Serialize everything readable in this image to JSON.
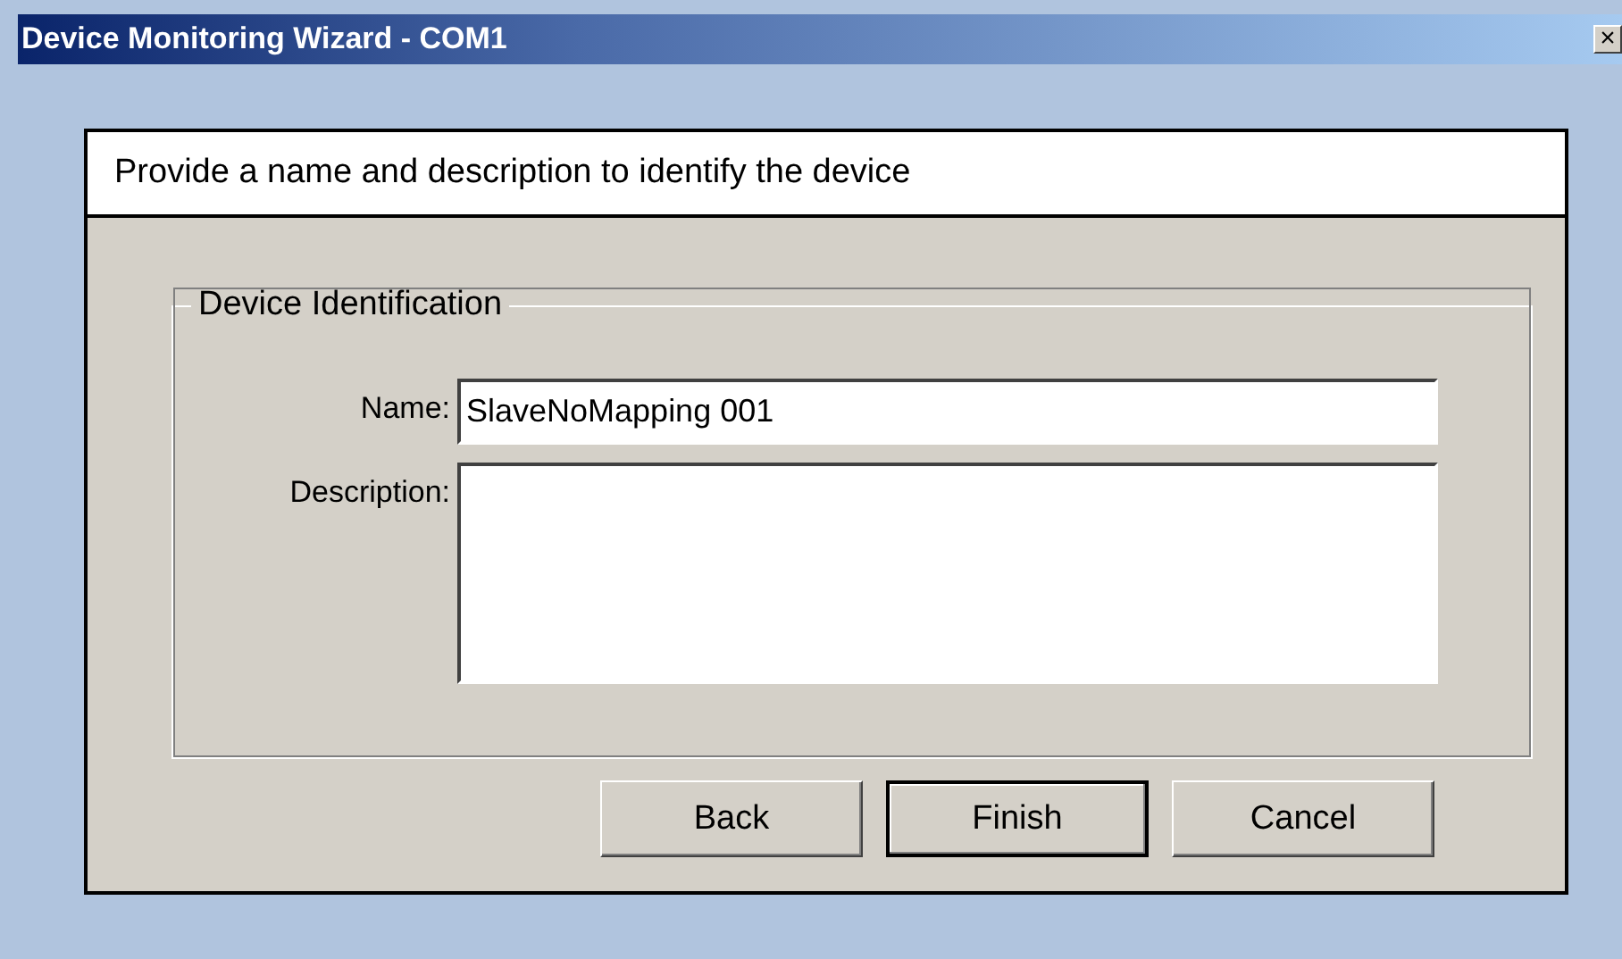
{
  "window": {
    "title": "Device Monitoring Wizard - COM1",
    "close": "×"
  },
  "header": {
    "text": "Provide a name and description to identify the device"
  },
  "group": {
    "title": "Device Identification",
    "fields": [
      {
        "kind": "line",
        "label": "Name:",
        "value": "SlaveNoMapping 001"
      },
      {
        "kind": "multiline",
        "label": "Description:"
      }
    ]
  },
  "buttons": [
    {
      "label": "Back",
      "default": false
    },
    {
      "label": "Finish",
      "default": true
    },
    {
      "label": "Cancel",
      "default": false
    }
  ]
}
